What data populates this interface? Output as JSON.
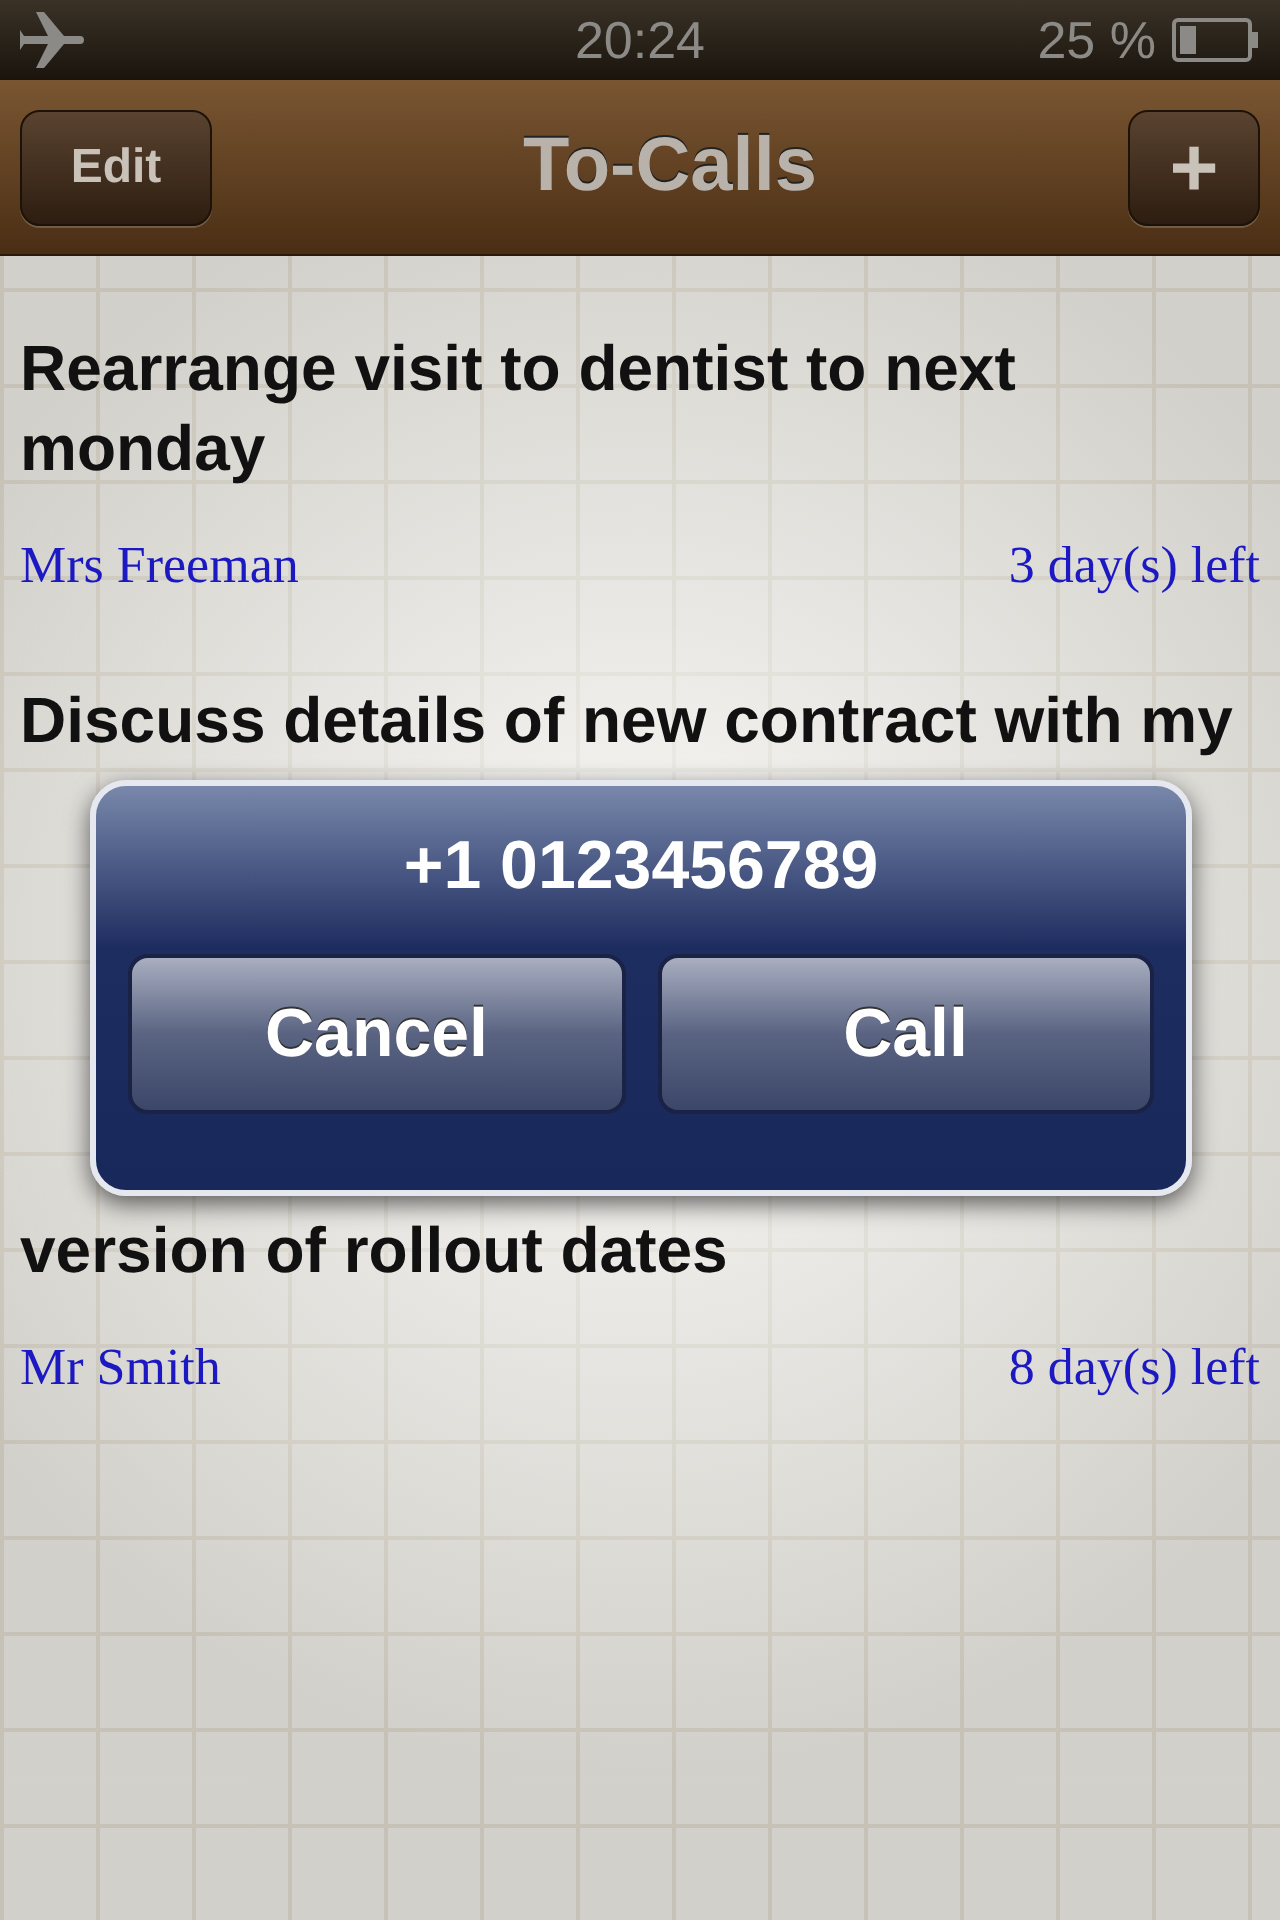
{
  "status_bar": {
    "airplane_mode": true,
    "time": "20:24",
    "battery": "25 %"
  },
  "nav_bar": {
    "left_button": "Edit",
    "title": "To-Calls",
    "right_button": "+"
  },
  "items": [
    {
      "title": "Rearrange visit to dentist to next monday",
      "contact": "Mrs Freeman",
      "due": "3 day(s) left"
    },
    {
      "title": "Discuss details of new contract with my"
    },
    {
      "title": "version of rollout dates",
      "contact": "Mr Smith",
      "due": "8 day(s) left"
    }
  ],
  "alert": {
    "title": "+1 0123456789",
    "buttons": [
      "Cancel",
      "Call"
    ]
  }
}
